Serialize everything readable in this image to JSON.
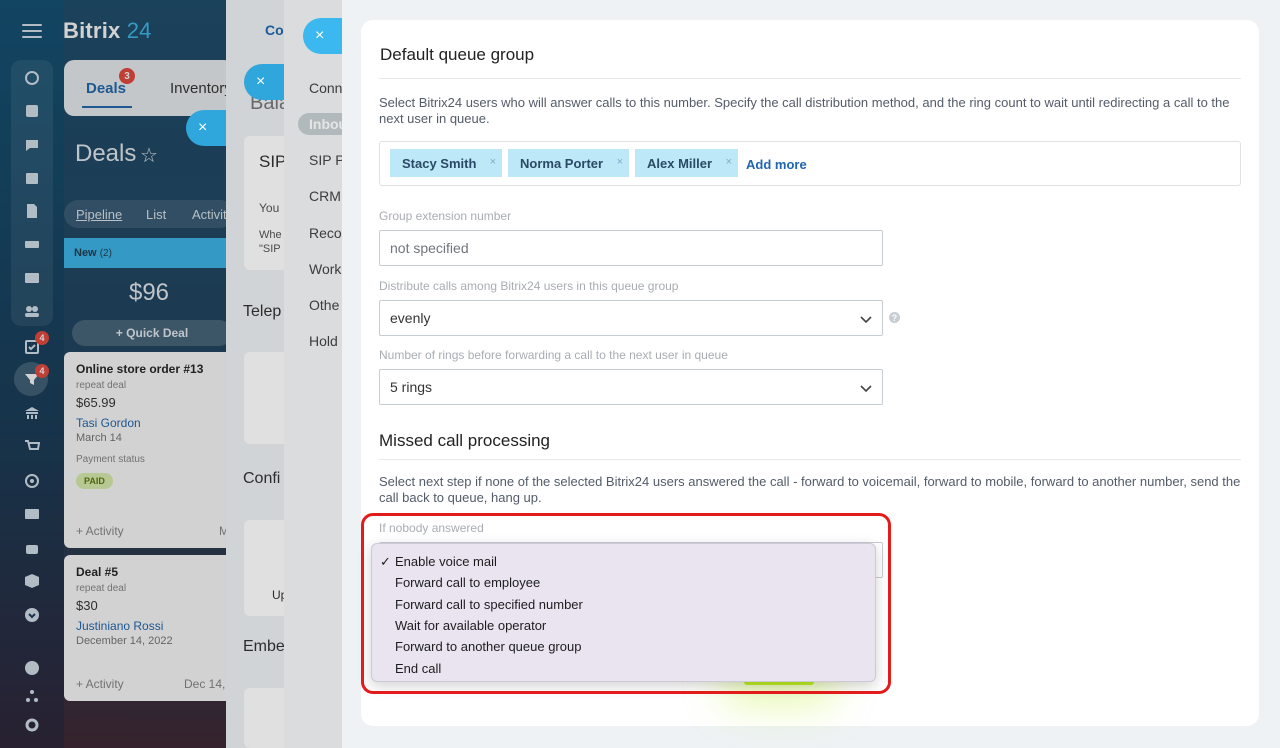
{
  "app": {
    "brand_main": "Bitrix",
    "brand_num": "24"
  },
  "rail": {
    "badge_tasks": "4",
    "badge_crm": "4"
  },
  "top_tabs": {
    "deals": "Deals",
    "deals_badge": "3",
    "inventory": "Inventory"
  },
  "deals_page": {
    "title": "Deals",
    "views": [
      "Pipeline",
      "List",
      "Activities"
    ],
    "column": {
      "name": "New",
      "count": "(2)",
      "total": "$96",
      "quick_deal": "Quick Deal"
    },
    "cards": [
      {
        "title": "Online store order #13",
        "sub": "repeat deal",
        "price": "$65.99",
        "contact": "Tasi Gordon",
        "date": "March 14",
        "status_label": "Payment status",
        "status": "PAID",
        "activity": "+ Activity",
        "activity_right": "M"
      },
      {
        "title": "Deal #5",
        "sub": "repeat deal",
        "price": "$30",
        "contact": "Justiniano Rossi",
        "date": "December 14, 2022",
        "activity": "+ Activity",
        "activity_right": "Dec 14,"
      }
    ]
  },
  "layer1": {
    "tab": "Co",
    "title_fragment": "Bala",
    "sip_title": "SIP",
    "sip_line1": "You",
    "sip_line2a": "Whe",
    "sip_line2b": "\"SIP",
    "telephony": "Telep",
    "config": "Confi",
    "embed": "Embe",
    "upload": "Up"
  },
  "layer2": {
    "items": [
      "Conn",
      "Inbou",
      "SIP P",
      "CRM",
      "Reco",
      "Work",
      "Othe",
      "Hold"
    ]
  },
  "close_icons": [
    "×",
    "×",
    "×"
  ],
  "panel": {
    "queue_title": "Default queue group",
    "queue_desc": "Select Bitrix24 users who will answer calls to this number. Specify the call distribution method, and the ring count to wait until redirecting a call to the next user in queue.",
    "users": [
      "Stacy Smith",
      "Norma Porter",
      "Alex Miller"
    ],
    "chip_remove": "×",
    "add_more": "Add more",
    "ext_label": "Group extension number",
    "ext_placeholder": "not specified",
    "distribute_label": "Distribute calls among Bitrix24 users in this queue group",
    "distribute_value": "evenly",
    "help": "?",
    "rings_label": "Number of rings before forwarding a call to the next user in queue",
    "rings_value": "5 rings",
    "missed_title": "Missed call processing",
    "missed_desc": "Select next step if none of the selected Bitrix24 users answered the call - forward to voicemail, forward to mobile, forward to another number, send the call back to queue, hang up.",
    "nobody_label": "If nobody answered",
    "dropdown": {
      "check": "✓",
      "options": [
        "Enable voice mail",
        "Forward call to employee",
        "Forward call to specified number",
        "Wait for available operator",
        "Forward to another queue group",
        "End call"
      ],
      "selected_index": 0
    }
  },
  "colors": {
    "accent": "#3bb8ef",
    "link": "#2067b0",
    "chip": "#bde8f7",
    "highlight": "#e21b1b",
    "save": "#bbed21"
  }
}
